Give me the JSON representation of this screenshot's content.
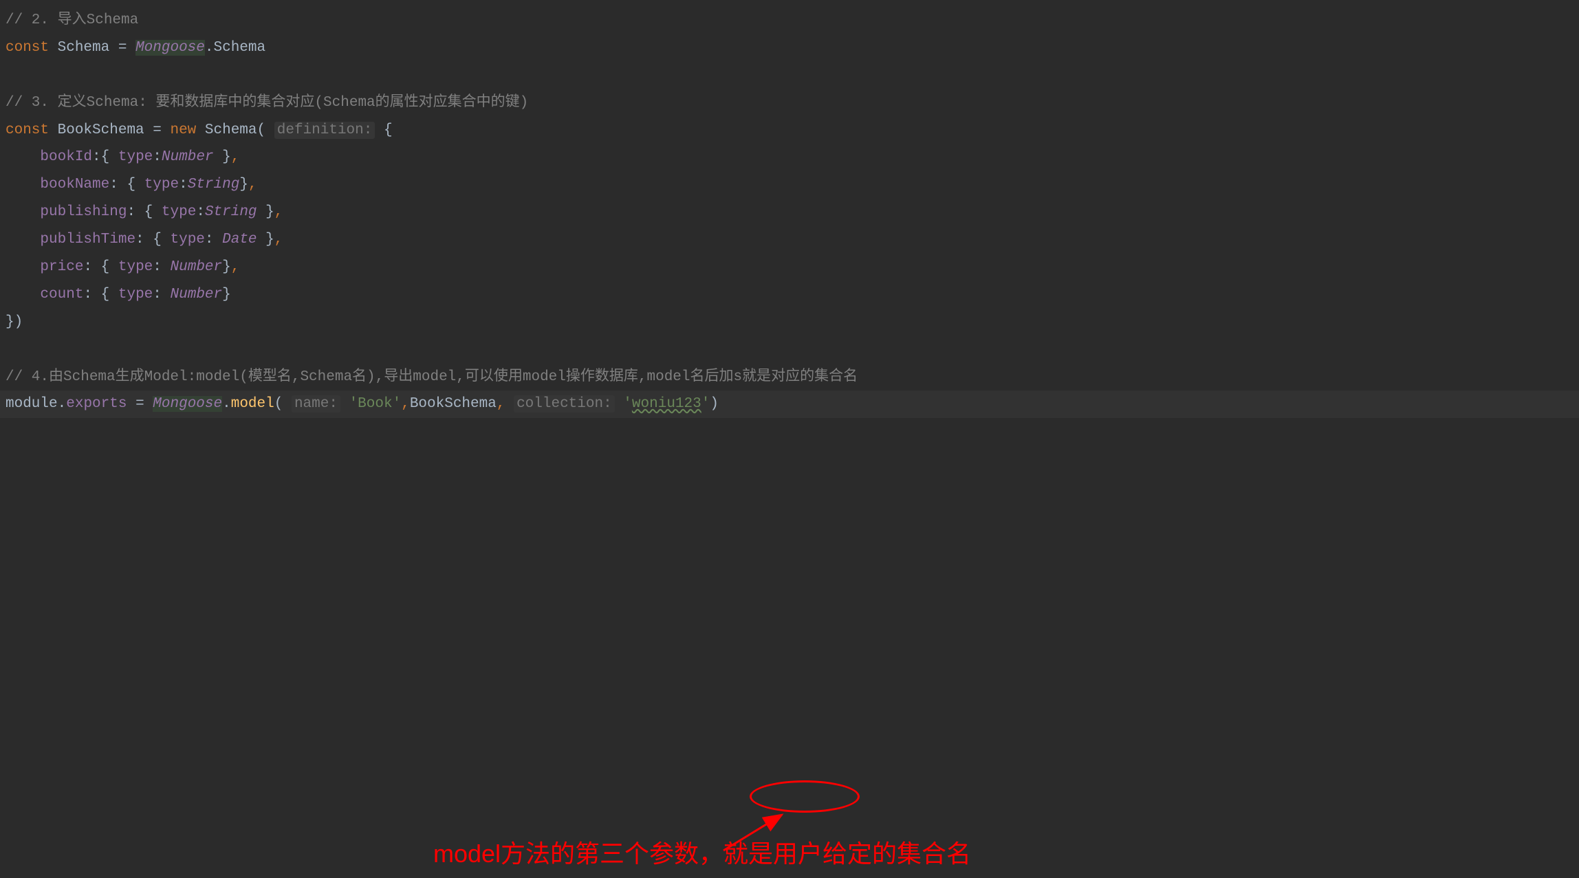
{
  "lines": {
    "l1": {
      "comment": "// 2. 导入Schema"
    },
    "l2": {
      "const": "const ",
      "schema": "Schema ",
      "equals": "= ",
      "mongoose": "Mongoose",
      "dot": ".",
      "schema2": "Schema"
    },
    "l3": {
      "comment": "// 3. 定义Schema: 要和数据库中的集合对应(Schema的属性对应集合中的键)"
    },
    "l4": {
      "const": "const ",
      "bookschema": "BookSchema ",
      "equals": "= ",
      "new": "new ",
      "schema": "Schema",
      "paren": "( ",
      "hint": "definition:",
      "space": " ",
      "brace": "{"
    },
    "l5": {
      "indent": "    ",
      "prop": "bookId",
      "colon": ":",
      "brace": "{ ",
      "type": "type",
      "colon2": ":",
      "typename": "Number",
      "end": " }",
      "comma": ","
    },
    "l6": {
      "indent": "    ",
      "prop": "bookName",
      "colon": ": ",
      "brace": "{ ",
      "type": "type",
      "colon2": ":",
      "typename": "String",
      "end": "}",
      "comma": ","
    },
    "l7": {
      "indent": "    ",
      "prop": "publishing",
      "colon": ": ",
      "brace": "{ ",
      "type": "type",
      "colon2": ":",
      "typename": "String",
      "end": " }",
      "comma": ","
    },
    "l8": {
      "indent": "    ",
      "prop": "publishTime",
      "colon": ": ",
      "brace": "{ ",
      "type": "type",
      "colon2": ": ",
      "typename": "Date",
      "end": " }",
      "comma": ","
    },
    "l9": {
      "indent": "    ",
      "prop": "price",
      "colon": ": ",
      "brace": "{ ",
      "type": "type",
      "colon2": ": ",
      "typename": "Number",
      "end": "}",
      "comma": ","
    },
    "l10": {
      "indent": "    ",
      "prop": "count",
      "colon": ": ",
      "brace": "{ ",
      "type": "type",
      "colon2": ": ",
      "typename": "Number",
      "end": "}"
    },
    "l11": {
      "close": "})"
    },
    "l12": {
      "comment": "// 4.由Schema生成Model:model(模型名,Schema名),导出model,可以使用model操作数据库,model名后加s就是对应的集合名"
    },
    "l13": {
      "module": "module",
      "dot1": ".",
      "exports": "exports ",
      "equals": "= ",
      "mongoose": "Mongoose",
      "dot2": ".",
      "model": "model",
      "paren": "( ",
      "hint1": "name:",
      "space1": " ",
      "str1": "'Book'",
      "comma1": ",",
      "bookschema": "BookSchema",
      "comma2": ", ",
      "hint2": "collection:",
      "space2": " ",
      "str2a": "'",
      "str2b": "woniu123",
      "str2c": "'",
      "paren2": ")"
    }
  },
  "annotation": {
    "text": "model方法的第三个参数，就是用户给定的集合名"
  }
}
